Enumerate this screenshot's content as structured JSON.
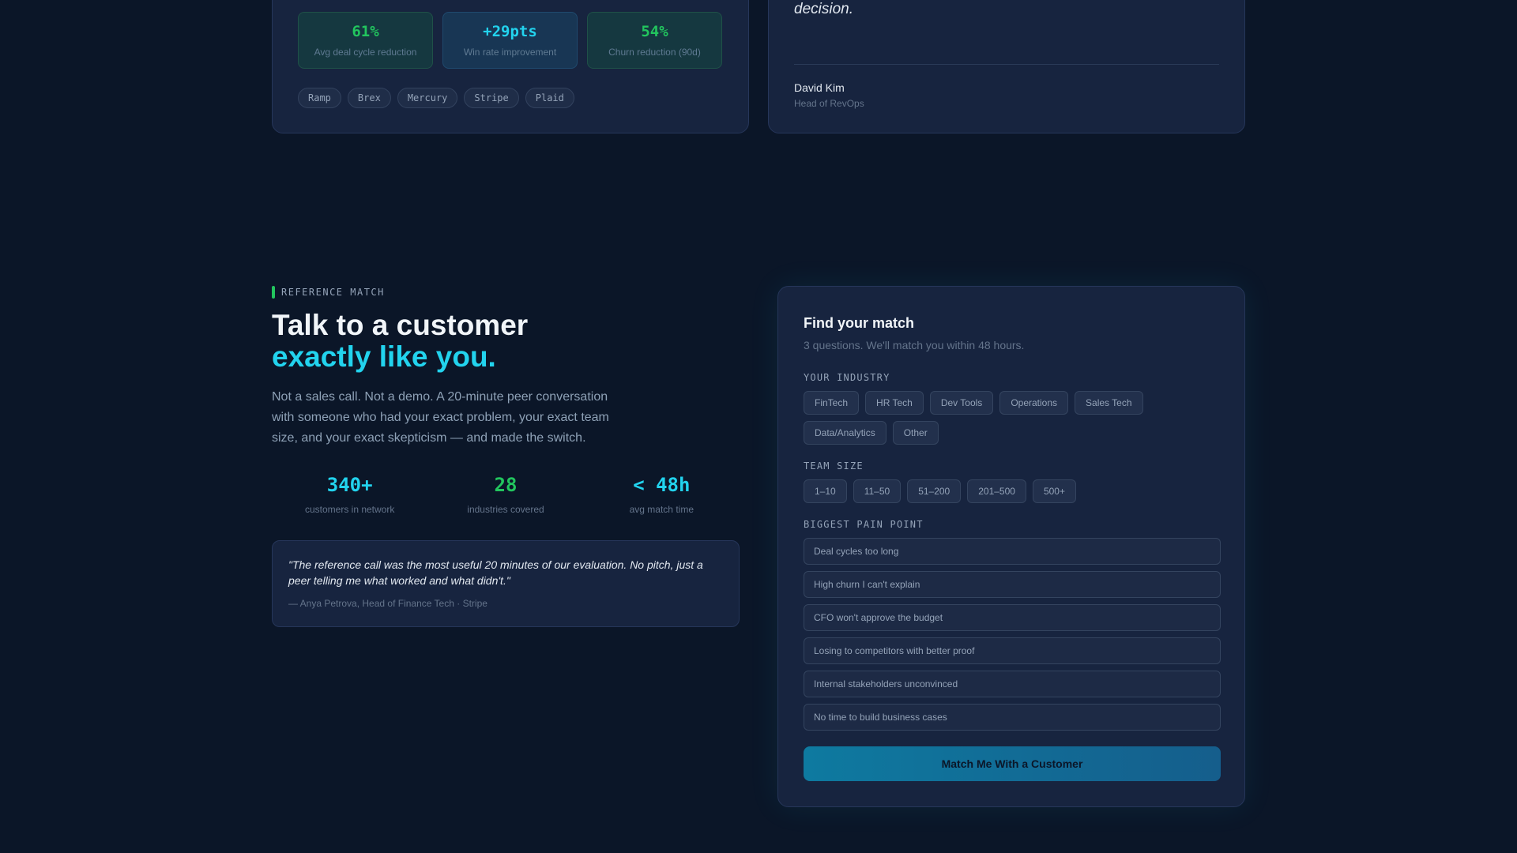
{
  "case_study": {
    "metrics": [
      {
        "value": "61%",
        "label": "Avg deal cycle reduction"
      },
      {
        "value": "+29pts",
        "label": "Win rate improvement"
      },
      {
        "value": "54%",
        "label": "Churn reduction (90d)"
      }
    ],
    "tags": [
      "Ramp",
      "Brex",
      "Mercury",
      "Stripe",
      "Plaid"
    ]
  },
  "quote_card": {
    "text": "decision.",
    "author_name": "David Kim",
    "author_role": "Head of RevOps"
  },
  "reference": {
    "eyebrow": "REFERENCE MATCH",
    "headline_line1": "Talk to a customer",
    "headline_line2": "exactly like you.",
    "lede": "Not a sales call. Not a demo. A 20-minute peer conversation with someone who had your exact problem, your exact team size, and your exact skepticism — and made the switch.",
    "stats": [
      {
        "value": "340+",
        "caption": "customers in network"
      },
      {
        "value": "28",
        "caption": "industries covered"
      },
      {
        "value": "< 48h",
        "caption": "avg match time"
      }
    ],
    "testimonial": {
      "quote": "\"The reference call was the most useful 20 minutes of our evaluation. No pitch, just a peer telling me what worked and what didn't.\"",
      "attribution": "— Anya Petrova, Head of Finance Tech · Stripe"
    }
  },
  "form": {
    "title": "Find your match",
    "subtitle": "3 questions. We'll match you within 48 hours.",
    "industry_label": "YOUR INDUSTRY",
    "industries": [
      "FinTech",
      "HR Tech",
      "Dev Tools",
      "Operations",
      "Sales Tech",
      "Data/Analytics",
      "Other"
    ],
    "team_size_label": "TEAM SIZE",
    "team_sizes": [
      "1–10",
      "11–50",
      "51–200",
      "201–500",
      "500+"
    ],
    "pain_label": "BIGGEST PAIN POINT",
    "pain_points": [
      "Deal cycles too long",
      "High churn I can't explain",
      "CFO won't approve the budget",
      "Losing to competitors with better proof",
      "Internal stakeholders unconvinced",
      "No time to build business cases"
    ],
    "cta": "Match Me With a Customer"
  }
}
